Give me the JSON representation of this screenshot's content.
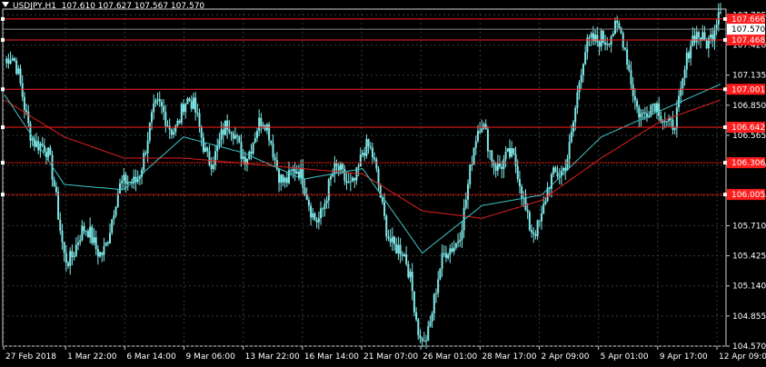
{
  "header": {
    "symbol": "USDJPY,H1",
    "ohlc": "107.610 107.627 107.567 107.570"
  },
  "colors": {
    "background": "#000000",
    "grid": "#3a3a3a",
    "candles": "#7fe8e8",
    "ma_fast": "#3ec6c6",
    "ma_slow": "#e02020",
    "hline": "#ff1c1c",
    "price_label_bg": "#ff1c1c",
    "current_price_bg": "#ffffff",
    "axis_text": "#ffffff"
  },
  "chart_data": {
    "type": "line",
    "title": "USDJPY,H1",
    "grid": true,
    "ylim": [
      104.57,
      107.76
    ],
    "y_ticks": [
      "107.705",
      "107.420",
      "107.135",
      "106.850",
      "106.565",
      "106.280",
      "105.995",
      "105.710",
      "105.425",
      "105.140",
      "104.855",
      "104.570"
    ],
    "x_ticks": [
      "27 Feb 2018",
      "1 Mar 22:00",
      "6 Mar 14:00",
      "9 Mar 06:00",
      "13 Mar 22:00",
      "16 Mar 14:00",
      "21 Mar 07:00",
      "26 Mar 01:00",
      "28 Mar 17:00",
      "2 Apr 09:00",
      "5 Apr 01:00",
      "9 Apr 17:00",
      "12 Apr 09:00"
    ],
    "current_price": "107.570",
    "horizontal_lines": [
      {
        "value": 107.666,
        "label": "107.666"
      },
      {
        "value": 107.468,
        "label": "107.468"
      },
      {
        "value": 107.001,
        "label": "107.001"
      },
      {
        "value": 106.642,
        "label": "106.642"
      },
      {
        "value": 106.306,
        "label": "106.306"
      },
      {
        "value": 106.005,
        "label": "106.005"
      }
    ],
    "series": [
      {
        "type": "price",
        "x": [
          "27 Feb 2018",
          "1 Mar 22:00",
          "6 Mar 14:00",
          "9 Mar 06:00",
          "13 Mar 22:00",
          "16 Mar 14:00",
          "21 Mar 07:00",
          "26 Mar 01:00",
          "28 Mar 17:00",
          "2 Apr 09:00",
          "5 Apr 01:00",
          "9 Apr 17:00",
          "12 Apr 09:00"
        ],
        "values": [
          107.25,
          105.62,
          105.9,
          106.95,
          106.4,
          106.15,
          106.2,
          104.9,
          106.35,
          105.95,
          107.45,
          106.85,
          107.57
        ]
      },
      {
        "type": "moving_average_fast",
        "values": [
          106.95,
          106.1,
          106.05,
          106.55,
          106.4,
          106.15,
          106.25,
          105.45,
          105.9,
          106.0,
          106.55,
          106.8,
          107.05
        ]
      },
      {
        "type": "moving_average_slow",
        "values": [
          106.9,
          106.55,
          106.35,
          106.35,
          106.3,
          106.25,
          106.2,
          105.85,
          105.78,
          105.95,
          106.35,
          106.7,
          106.9
        ]
      }
    ]
  }
}
